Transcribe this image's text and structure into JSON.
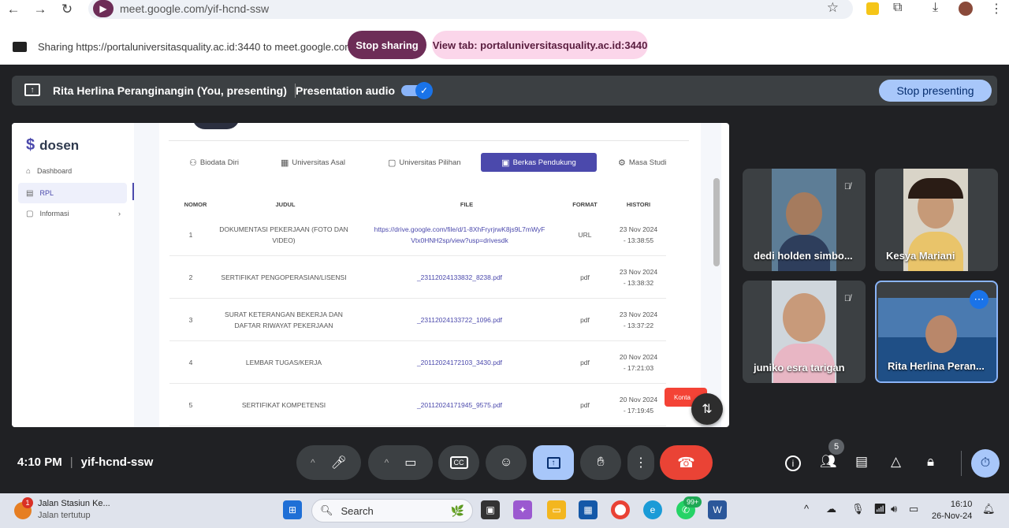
{
  "browser": {
    "url": "meet.google.com/yif-hcnd-ssw",
    "sharing_text": "Sharing https://portaluniversitasquality.ac.id:3440 to meet.google.com",
    "stop_sharing": "Stop sharing",
    "view_tab": "View tab: portaluniversitasquality.ac.id:3440"
  },
  "presenting": {
    "name": "Rita Herlina Peranginangin (You, presenting)",
    "audio_label": "Presentation audio",
    "stop_presenting": "Stop presenting"
  },
  "portal": {
    "logo": "dosen",
    "sidebar": [
      {
        "label": "Dashboard",
        "icon": "home-icon"
      },
      {
        "label": "RPL",
        "icon": "document-icon",
        "active": true
      },
      {
        "label": "Informasi",
        "icon": "info-icon",
        "chevron": "›"
      }
    ],
    "tabs": [
      {
        "label": "Biodata Diri",
        "icon": "user-icon"
      },
      {
        "label": "Universitas Asal",
        "icon": "building-icon"
      },
      {
        "label": "Universitas Pilihan",
        "icon": "university-icon"
      },
      {
        "label": "Berkas Pendukung",
        "icon": "folder-icon",
        "active": true
      },
      {
        "label": "Masa Studi",
        "icon": "gear-icon"
      }
    ],
    "columns": [
      "NOMOR",
      "JUDUL",
      "FILE",
      "FORMAT",
      "HISTORI"
    ],
    "rows": [
      {
        "no": "1",
        "judul": "DOKUMENTASI PEKERJAAN (FOTO DAN VIDEO)",
        "file": "https://drive.google.com/file/d/1-8XhFryrjrwK8js9L7mWyFVtx0HNH2sp/view?usp=drivesdk",
        "format": "URL",
        "histori": "23 Nov 2024 - 13:38:55"
      },
      {
        "no": "2",
        "judul": "SERTIFIKAT PENGOPERASIAN/LISENSI",
        "file": "_23112024133832_8238.pdf",
        "format": "pdf",
        "histori": "23 Nov 2024 - 13:38:32"
      },
      {
        "no": "3",
        "judul": "SURAT KETERANGAN BEKERJA DAN DAFTAR RIWAYAT PEKERJAAN",
        "file": "_23112024133722_1096.pdf",
        "format": "pdf",
        "histori": "23 Nov 2024 - 13:37:22"
      },
      {
        "no": "4",
        "judul": "LEMBAR TUGAS/KERJA",
        "file": "_20112024172103_3430.pdf",
        "format": "pdf",
        "histori": "20 Nov 2024 - 17:21:03"
      },
      {
        "no": "5",
        "judul": "SERTIFIKAT KOMPETENSI",
        "file": "_20112024171945_9575.pdf",
        "format": "pdf",
        "histori": "20 Nov 2024 - 17:19:45"
      }
    ],
    "kontak": "Konta"
  },
  "participants": [
    {
      "name": "dedi holden simbo...",
      "muted": true
    },
    {
      "name": "Kesya Mariani",
      "muted": false
    },
    {
      "name": "juniko esra tarigan",
      "muted": true
    },
    {
      "name": "Rita Herlina Peran...",
      "muted": false,
      "self": true
    }
  ],
  "meeting": {
    "time": "4:10 PM",
    "code": "yif-hcnd-ssw",
    "people_count": "5"
  },
  "taskbar": {
    "weather_title": "Jalan Stasiun Ke...",
    "weather_sub": "Jalan tertutup",
    "weather_badge": "1",
    "search": "Search",
    "whatsapp_badge": "99+",
    "time": "16:10",
    "date": "26-Nov-24"
  },
  "colors": {
    "accent": "#4b49ac",
    "meet_blue": "#a8c7fa",
    "end_call": "#ea4335",
    "stop_sharing": "#6d2d57"
  }
}
